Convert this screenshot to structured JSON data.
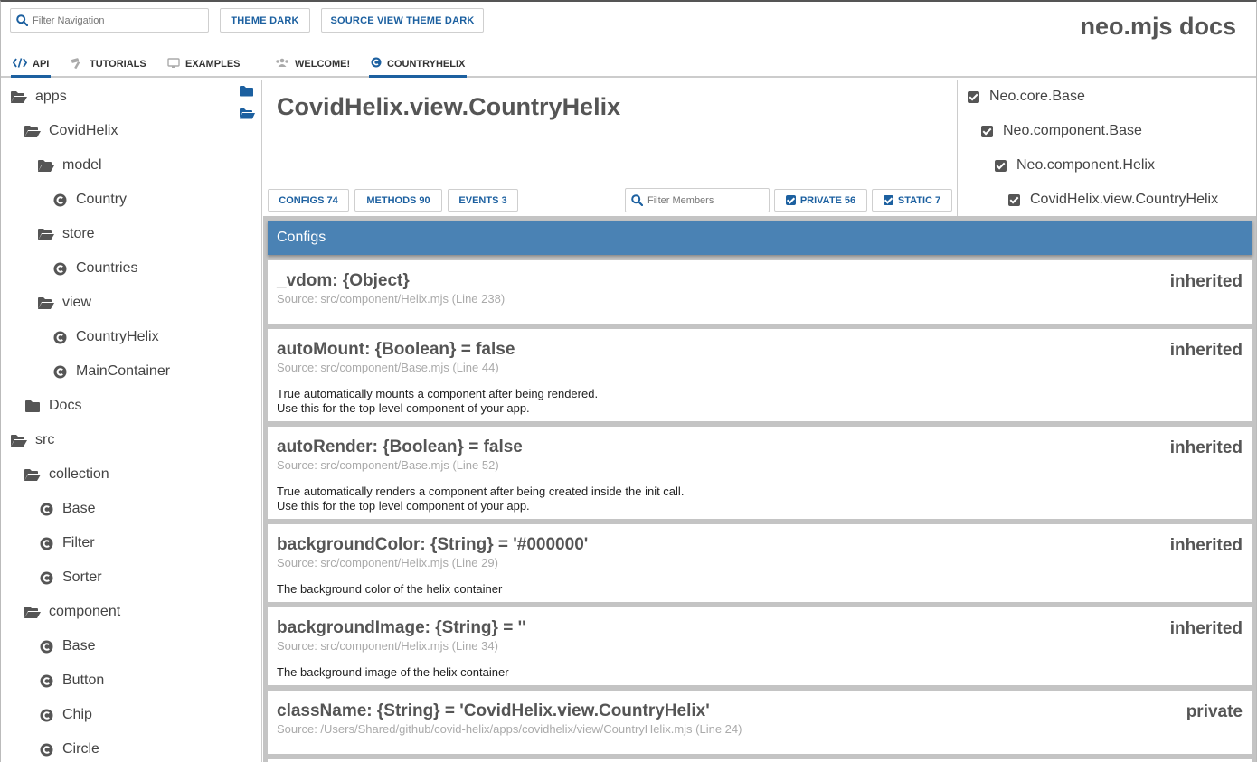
{
  "header": {
    "filter_placeholder": "Filter Navigation",
    "theme_button": "THEME DARK",
    "source_theme_button": "SOURCE VIEW THEME DARK",
    "app_title": "neo.mjs docs"
  },
  "tabs": [
    {
      "label": "API",
      "icon": "code-icon",
      "active": true
    },
    {
      "label": "TUTORIALS",
      "icon": "hammer-icon",
      "active": false
    },
    {
      "label": "EXAMPLES",
      "icon": "desktop-icon",
      "active": false
    },
    {
      "label": "WELCOME!",
      "icon": "users-icon",
      "active": false
    },
    {
      "label": "COUNTRYHELIX",
      "icon": "class-icon",
      "active": true
    }
  ],
  "tree": [
    {
      "label": "apps",
      "type": "folder-open",
      "level": 0
    },
    {
      "label": "CovidHelix",
      "type": "folder-open",
      "level": 1
    },
    {
      "label": "model",
      "type": "folder-open",
      "level": 2
    },
    {
      "label": "Country",
      "type": "class",
      "level": 3
    },
    {
      "label": "store",
      "type": "folder-open",
      "level": 2
    },
    {
      "label": "Countries",
      "type": "class",
      "level": 3
    },
    {
      "label": "view",
      "type": "folder-open",
      "level": 2
    },
    {
      "label": "CountryHelix",
      "type": "class",
      "level": 3
    },
    {
      "label": "MainContainer",
      "type": "class",
      "level": 3
    },
    {
      "label": "Docs",
      "type": "folder",
      "level": 1
    },
    {
      "label": "src",
      "type": "folder-open",
      "level": 0
    },
    {
      "label": "collection",
      "type": "folder-open",
      "level": 1
    },
    {
      "label": "Base",
      "type": "class",
      "level": 2
    },
    {
      "label": "Filter",
      "type": "class",
      "level": 2
    },
    {
      "label": "Sorter",
      "type": "class",
      "level": 2
    },
    {
      "label": "component",
      "type": "folder-open",
      "level": 1
    },
    {
      "label": "Base",
      "type": "class",
      "level": 2
    },
    {
      "label": "Button",
      "type": "class",
      "level": 2
    },
    {
      "label": "Chip",
      "type": "class",
      "level": 2
    },
    {
      "label": "Circle",
      "type": "class",
      "level": 2
    }
  ],
  "main": {
    "class_title": "CovidHelix.view.CountryHelix",
    "configs_label": "CONFIGS 74",
    "methods_label": "METHODS 90",
    "events_label": "EVENTS 3",
    "filter_members_placeholder": "Filter Members",
    "private_label": "PRIVATE 56",
    "static_label": "STATIC 7"
  },
  "hierarchy": [
    {
      "label": "Neo.core.Base",
      "checked": true
    },
    {
      "label": "Neo.component.Base",
      "checked": true
    },
    {
      "label": "Neo.component.Helix",
      "checked": true
    },
    {
      "label": "CovidHelix.view.CountryHelix",
      "checked": true
    }
  ],
  "members": {
    "section_title": "Configs",
    "items": [
      {
        "name": "_vdom: {Object}",
        "source": "Source: src/component/Helix.mjs (Line 238)",
        "desc": [],
        "tag": "inherited"
      },
      {
        "name": "autoMount: {Boolean} = false",
        "source": "Source: src/component/Base.mjs (Line 44)",
        "desc": [
          "True automatically mounts a component after being rendered.",
          "Use this for the top level component of your app."
        ],
        "tag": "inherited"
      },
      {
        "name": "autoRender: {Boolean} = false",
        "source": "Source: src/component/Base.mjs (Line 52)",
        "desc": [
          "True automatically renders a component after being created inside the init call.",
          "Use this for the top level component of your app."
        ],
        "tag": "inherited"
      },
      {
        "name": "backgroundColor: {String} = '#000000'",
        "source": "Source: src/component/Helix.mjs (Line 29)",
        "desc": [
          "The background color of the helix container"
        ],
        "tag": "inherited"
      },
      {
        "name": "backgroundImage: {String} = ''",
        "source": "Source: src/component/Helix.mjs (Line 34)",
        "desc": [
          "The background image of the helix container"
        ],
        "tag": "inherited"
      },
      {
        "name": "className: {String} = 'CovidHelix.view.CountryHelix'",
        "source": "Source: /Users/Shared/github/covid-helix/apps/covidhelix/view/CountryHelix.mjs (Line 24)",
        "desc": [],
        "tag": "private"
      }
    ]
  },
  "colors": {
    "accent": "#1c60a0",
    "section_header": "#4a82b4"
  }
}
